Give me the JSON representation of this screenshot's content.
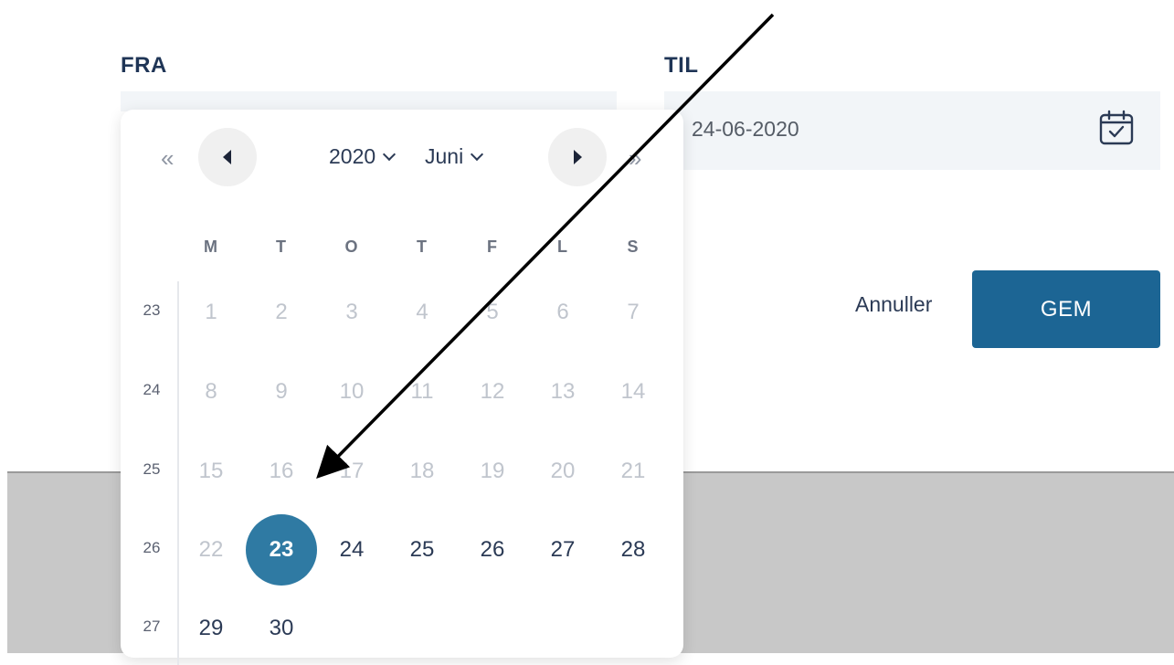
{
  "from": {
    "label": "FRA"
  },
  "to": {
    "label": "TIL",
    "value": "24-06-2020",
    "icon": "calendar-check-icon"
  },
  "actions": {
    "cancel_label": "Annuller",
    "save_label": "GEM",
    "save_color": "#1c6594"
  },
  "calendar": {
    "year": "2020",
    "month": "Juni",
    "prev_year_glyph": "«",
    "next_year_glyph": "»",
    "weekdays": [
      "M",
      "T",
      "O",
      "T",
      "F",
      "L",
      "S"
    ],
    "weeks": [
      {
        "number": "23",
        "days": [
          "1",
          "2",
          "3",
          "4",
          "5",
          "6",
          "7"
        ]
      },
      {
        "number": "24",
        "days": [
          "8",
          "9",
          "10",
          "11",
          "12",
          "13",
          "14"
        ]
      },
      {
        "number": "25",
        "days": [
          "15",
          "16",
          "17",
          "18",
          "19",
          "20",
          "21"
        ]
      },
      {
        "number": "26",
        "days": [
          "22",
          "23",
          "24",
          "25",
          "26",
          "27",
          "28"
        ]
      },
      {
        "number": "27",
        "days": [
          "29",
          "30"
        ]
      }
    ],
    "selected_day": "23",
    "selected_color": "#2f7aa3"
  }
}
